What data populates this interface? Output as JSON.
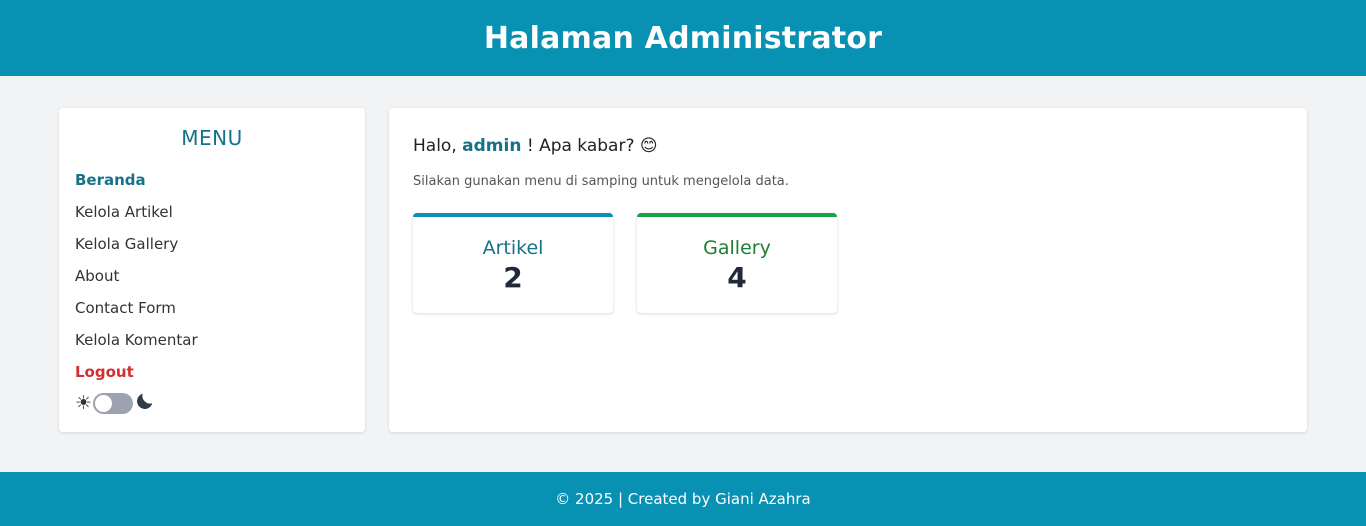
{
  "header": {
    "title": "Halaman Administrator"
  },
  "sidebar": {
    "title": "MENU",
    "items": [
      {
        "label": "Beranda"
      },
      {
        "label": "Kelola Artikel"
      },
      {
        "label": "Kelola Gallery"
      },
      {
        "label": "About"
      },
      {
        "label": "Contact Form"
      },
      {
        "label": "Kelola Komentar"
      },
      {
        "label": "Logout"
      }
    ],
    "theme_toggle": {
      "light_icon": "sun-icon",
      "dark_icon": "moon-icon",
      "state": "light"
    }
  },
  "main": {
    "greeting_prefix": "Halo,",
    "username": "admin",
    "greeting_suffix": "! Apa kabar? 😊",
    "subtext": "Silakan gunakan menu di samping untuk mengelola data.",
    "cards": [
      {
        "title": "Artikel",
        "count": "2",
        "accent": "#0891b2"
      },
      {
        "title": "Gallery",
        "count": "4",
        "accent": "#16a34a"
      }
    ]
  },
  "footer": {
    "text": "© 2025 | Created by Giani Azahra"
  },
  "colors": {
    "brand": "#0891b2",
    "logout": "#d32f2f",
    "background": "#f2f3f5"
  }
}
